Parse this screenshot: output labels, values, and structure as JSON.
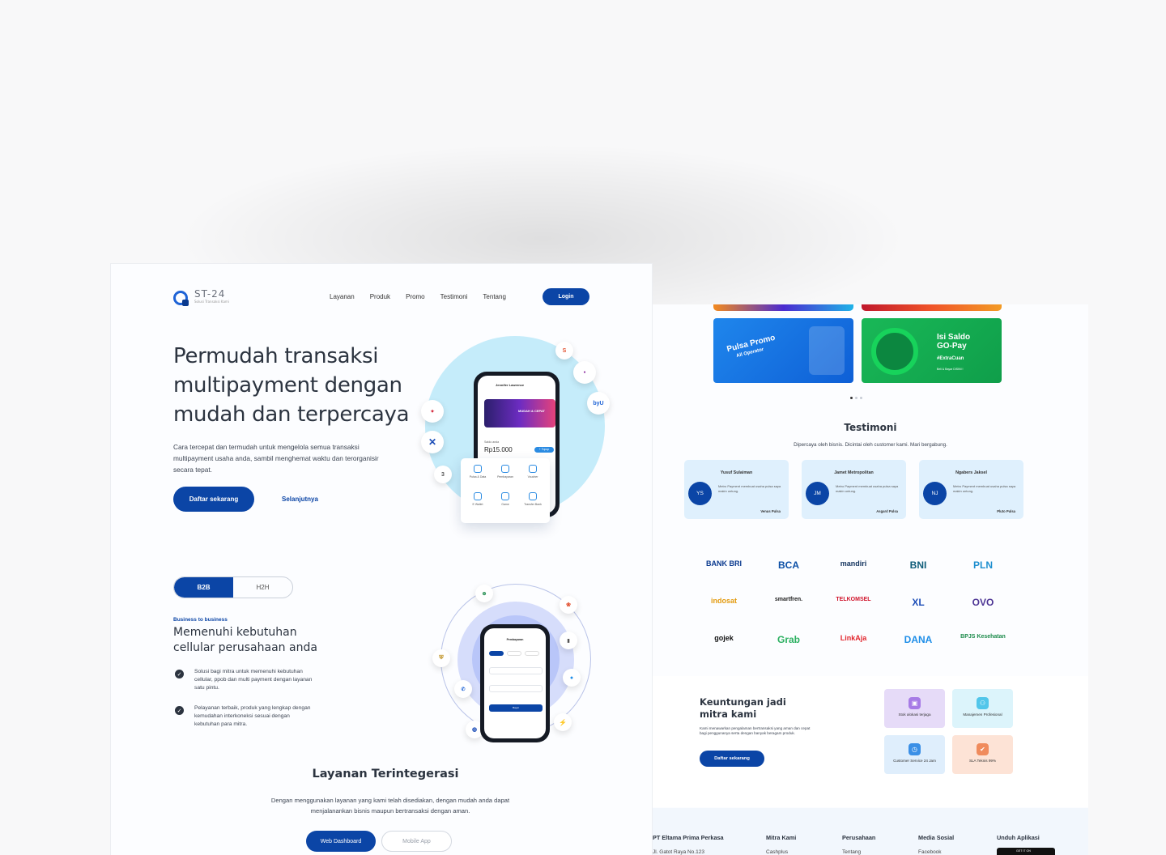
{
  "brand": {
    "name": "ST-24",
    "tagline": "Solusi Transaksi Kami",
    "accent": "#0b45a6"
  },
  "nav": {
    "links": [
      "Layanan",
      "Produk",
      "Promo",
      "Testimoni",
      "Tentang"
    ],
    "login": "Login"
  },
  "hero": {
    "title": "Permudah transaksi multipayment dengan mudah dan terpercaya",
    "desc": "Cara tercepat dan termudah untuk mengelola semua transaksi multipayment usaha anda, sambil menghemat waktu dan terorganisir secara tepat.",
    "cta": "Daftar sekarang",
    "next": "Selanjutnya",
    "phone": {
      "user": "Jennifer Lawrence",
      "banner": "MUDAH & CEPAT",
      "saldo_label": "Saldo anda",
      "saldo": "Rp15.000",
      "topup": "+ Topup",
      "services": [
        "Pulsa & Data",
        "Pembayaran",
        "Voucher",
        "E Wallet",
        "Game",
        "Transfer Bank"
      ]
    },
    "bubbles": [
      "S",
      "byU",
      "3"
    ]
  },
  "b2b": {
    "tabs": [
      "B2B",
      "H2H"
    ],
    "eyebrow": "Business to business",
    "title": "Memenuhi kebutuhan cellular perusahaan anda",
    "items": [
      "Solusi bagi mitra untuk memenuhi kebutuhan cellular, ppob dan multi payment dengan layanan satu pintu.",
      "Pelayanan terbaik, produk yang lengkap dengan kemudahan interkoneksi sesuai dengan kebutuhan para mitra."
    ],
    "phone": {
      "title": "Pembayaran",
      "button": "Bayar"
    }
  },
  "layanan": {
    "title": "Layanan Terintegerasi",
    "desc": "Dengan menggunakan layanan yang kami telah disediakan, dengan mudah anda dapat menjalanankan bisnis maupun bertransaksi dengan aman.",
    "buttons": [
      "Web Dashboard",
      "Mobile App"
    ]
  },
  "promos": [
    {
      "title": "Pulsa Promo",
      "sub": "All Operator"
    },
    {
      "title": "Isi Saldo GO-Pay",
      "sub": "#ExtraCuan",
      "note": "Beli & Bayar DISINI !"
    }
  ],
  "testimoni": {
    "title": "Testimoni",
    "sub": "Dipercaya oleh bisnis. Dicintai oleh customer kami. Mari bergabung.",
    "cards": [
      {
        "name": "Yusuf Sulaiman",
        "initials": "YS",
        "text": "Metro Payment membuat usaha pulsa saya makin untung.",
        "company": "Venus Pulsa"
      },
      {
        "name": "Jamet Metropolitan",
        "initials": "JM",
        "text": "Metro Payment membuat usaha pulsa saya makin untung.",
        "company": "Asgard Pulsa"
      },
      {
        "name": "Ngabers Jaksel",
        "initials": "NJ",
        "text": "Metro Payment membuat usaha pulsa saya makin untung.",
        "company": "Pluto Pulsa"
      }
    ]
  },
  "partners": [
    {
      "name": "BANK BRI",
      "color": "#0b3a8f"
    },
    {
      "name": "BCA",
      "color": "#0b4fa6"
    },
    {
      "name": "mandiri",
      "color": "#12335e"
    },
    {
      "name": "BNI",
      "color": "#0d5b78"
    },
    {
      "name": "PLN",
      "color": "#1e8fcf"
    },
    {
      "name": "indosat",
      "color": "#e39a0e"
    },
    {
      "name": "smartfren.",
      "color": "#222222"
    },
    {
      "name": "TELKOMSEL",
      "color": "#d0132a"
    },
    {
      "name": "XL",
      "color": "#1e4fb8"
    },
    {
      "name": "OVO",
      "color": "#4c3494"
    },
    {
      "name": "gojek",
      "color": "#111111"
    },
    {
      "name": "Grab",
      "color": "#2bb060"
    },
    {
      "name": "LinkAja",
      "color": "#e2252c"
    },
    {
      "name": "DANA",
      "color": "#1e8ee8"
    },
    {
      "name": "BPJS Kesehatan",
      "color": "#1b8a4a"
    }
  ],
  "keuntungan": {
    "title": "Keuntungan jadi mitra kami",
    "desc": "Kami menawarkan pengalaman bertransaksi yang aman dan cepat bagi penggunanya serta dengan banyak beragam produk.",
    "cta": "Daftar sekarang",
    "features": [
      {
        "label": "Stok alokasi terjaga",
        "bg": "#e6dbf8",
        "icon_bg": "#a77be6"
      },
      {
        "label": "Manajemen Profesional",
        "bg": "#dcf4fb",
        "icon_bg": "#52c6ea"
      },
      {
        "label": "Customer Service 24 Jam",
        "bg": "#dfeefc",
        "icon_bg": "#3a8fe6"
      },
      {
        "label": "SLA Teknis 99%",
        "bg": "#fde3d6",
        "icon_bg": "#f08b5c"
      }
    ]
  },
  "footer": {
    "cols": [
      {
        "head": "PT Eltama Prima Perkasa",
        "item": "Jl. Gatot Raya No.123"
      },
      {
        "head": "Mitra Kami",
        "item": "Cashplus"
      },
      {
        "head": "Perusahaan",
        "item": "Tentang"
      },
      {
        "head": "Media Sosial",
        "item": "Facebook"
      },
      {
        "head": "Unduh Aplikasi",
        "item": "GET IT ON"
      }
    ]
  }
}
